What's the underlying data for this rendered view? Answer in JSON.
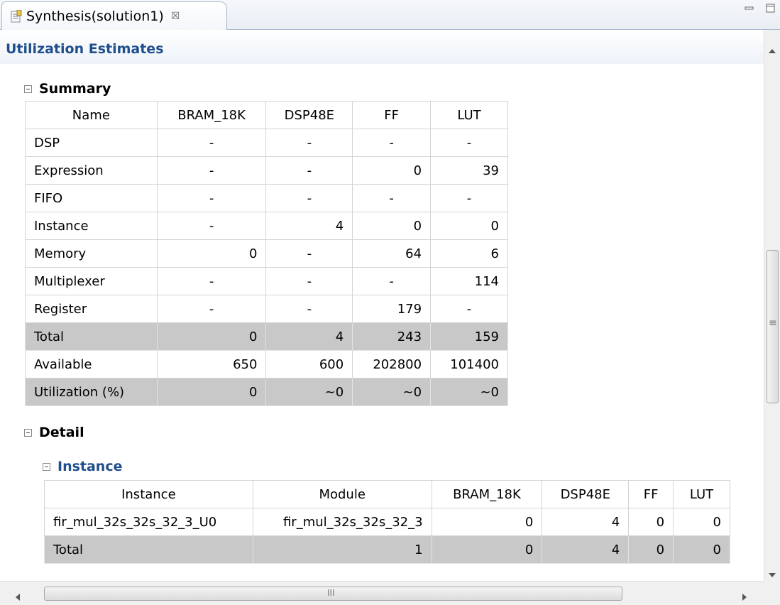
{
  "tab": {
    "title": "Synthesis(solution1)",
    "close": "☒"
  },
  "page": {
    "title": "Utilization Estimates"
  },
  "summary": {
    "heading": "Summary",
    "columns": [
      "Name",
      "BRAM_18K",
      "DSP48E",
      "FF",
      "LUT"
    ],
    "rows": [
      [
        "DSP",
        "-",
        "-",
        "-",
        "-"
      ],
      [
        "Expression",
        "-",
        "-",
        "0",
        "39"
      ],
      [
        "FIFO",
        "-",
        "-",
        "-",
        "-"
      ],
      [
        "Instance",
        "-",
        "4",
        "0",
        "0"
      ],
      [
        "Memory",
        "0",
        "-",
        "64",
        "6"
      ],
      [
        "Multiplexer",
        "-",
        "-",
        "-",
        "114"
      ],
      [
        "Register",
        "-",
        "-",
        "179",
        "-"
      ],
      [
        "Total",
        "0",
        "4",
        "243",
        "159"
      ],
      [
        "Available",
        "650",
        "600",
        "202800",
        "101400"
      ],
      [
        "Utilization (%)",
        "0",
        "~0",
        "~0",
        "~0"
      ]
    ]
  },
  "detail": {
    "heading": "Detail",
    "instance": {
      "heading": "Instance",
      "columns": [
        "Instance",
        "Module",
        "BRAM_18K",
        "DSP48E",
        "FF",
        "LUT"
      ],
      "rows": [
        [
          "fir_mul_32s_32s_32_3_U0",
          "fir_mul_32s_32s_32_3",
          "0",
          "4",
          "0",
          "0"
        ],
        [
          "Total",
          "1",
          "0",
          "4",
          "0",
          "0"
        ]
      ]
    }
  },
  "scrollbar": {
    "grip": "≡",
    "hgrip": "III"
  }
}
